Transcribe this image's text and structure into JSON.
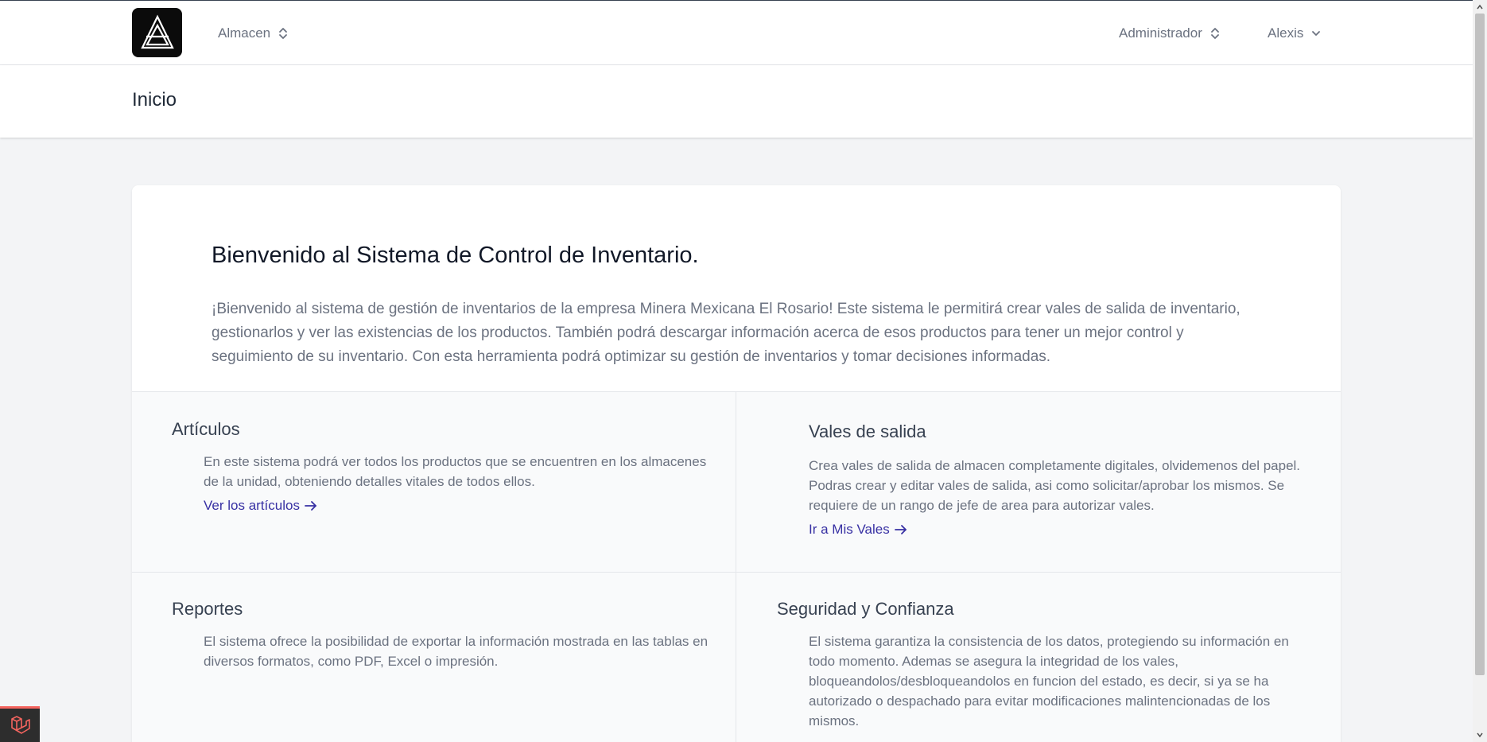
{
  "navbar": {
    "warehouse_selector": "Almacen",
    "role_selector": "Administrador",
    "user_menu": "Alexis"
  },
  "header": {
    "title": "Inicio"
  },
  "welcome": {
    "title": "Bienvenido al Sistema de Control de Inventario.",
    "text": "¡Bienvenido al sistema de gestión de inventarios de la empresa Minera Mexicana El Rosario! Este sistema le permitirá crear vales de salida de inventario, gestionarlos y ver las existencias de los productos. También podrá descargar información acerca de esos productos para tener un mejor control y seguimiento de su inventario. Con esta herramienta podrá optimizar su gestión de inventarios y tomar decisiones informadas."
  },
  "features": {
    "articulos": {
      "title": "Artículos",
      "text": "En este sistema podrá ver todos los productos que se encuentren en los almacenes de la unidad, obteniendo detalles vitales de todos ellos.",
      "link": "Ver los artículos"
    },
    "vales": {
      "title": "Vales de salida",
      "text": "Crea vales de salida de almacen completamente digitales, olvidemenos del papel. Podras crear y editar vales de salida, asi como solicitar/aprobar los mismos. Se requiere de un rango de jefe de area para autorizar vales.",
      "link": "Ir a Mis Vales"
    },
    "reportes": {
      "title": "Reportes",
      "text": "El sistema ofrece la posibilidad de exportar la información mostrada en las tablas en diversos formatos, como PDF, Excel o impresión."
    },
    "seguridad": {
      "title": "Seguridad y Confianza",
      "text": "El sistema garantiza la consistencia de los datos, protegiendo su información en todo momento. Ademas se asegura la integridad de los vales, bloqueandolos/desbloqueandolos en funcion del estado, es decir, si ya se ha autorizado o despachado para evitar modificaciones malintencionadas de los mismos."
    }
  },
  "colors": {
    "link": "#3730a3",
    "background": "#f3f4f6",
    "logo_bg": "#0b0b0b",
    "debugbar_accent": "#f4645f"
  },
  "icons": {
    "logo": "triangle-logo-icon",
    "selector": "chevron-up-down-icon",
    "dropdown": "chevron-down-icon",
    "link_arrow": "arrow-right-icon",
    "debugbar": "laravel-icon"
  }
}
